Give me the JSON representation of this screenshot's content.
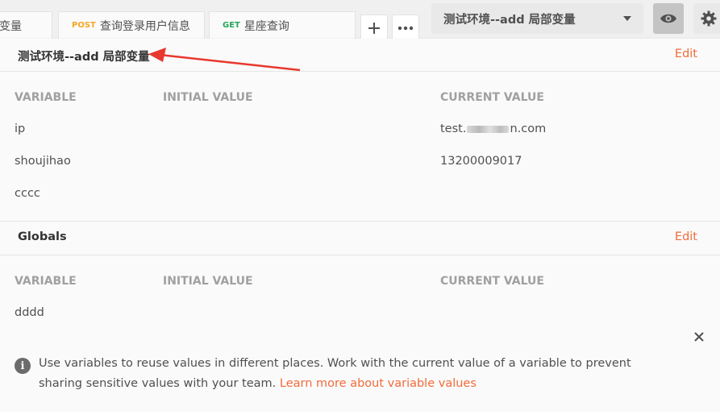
{
  "tabs": [
    {
      "method": "",
      "label": "变量"
    },
    {
      "method": "POST",
      "label": "查询登录用户信息",
      "method_color": "#f5a623"
    },
    {
      "method": "GET",
      "label": "星座查询",
      "method_color": "#26a65b"
    }
  ],
  "tab_actions": {
    "add_icon": "plus-icon",
    "more_icon": "ellipsis-icon"
  },
  "environment": {
    "selected": "测试环境--add 局部变量"
  },
  "toolbar": {
    "eye_icon": "eye-icon",
    "settings_icon": "gear-icon"
  },
  "env_section": {
    "title": "测试环境--add 局部变量",
    "edit_label": "Edit",
    "columns": {
      "variable": "VARIABLE",
      "initial": "INITIAL VALUE",
      "current": "CURRENT VALUE"
    },
    "rows": [
      {
        "variable": "ip",
        "initial": "",
        "current_prefix": "test.",
        "current_suffix": "n.com"
      },
      {
        "variable": "shoujihao",
        "initial": "",
        "current": "13200009017"
      },
      {
        "variable": "cccc",
        "initial": "",
        "current": ""
      }
    ]
  },
  "globals_section": {
    "title": "Globals",
    "edit_label": "Edit",
    "columns": {
      "variable": "VARIABLE",
      "initial": "INITIAL VALUE",
      "current": "CURRENT VALUE"
    },
    "rows": [
      {
        "variable": "dddd",
        "initial": "",
        "current": ""
      }
    ]
  },
  "info": {
    "text": "Use variables to reuse values in different places. Work with the current value of a variable to prevent sharing sensitive values with your team.",
    "link": "Learn more about variable values"
  },
  "colors": {
    "accent": "#f26b3a",
    "annotation_arrow": "#e8382f"
  }
}
